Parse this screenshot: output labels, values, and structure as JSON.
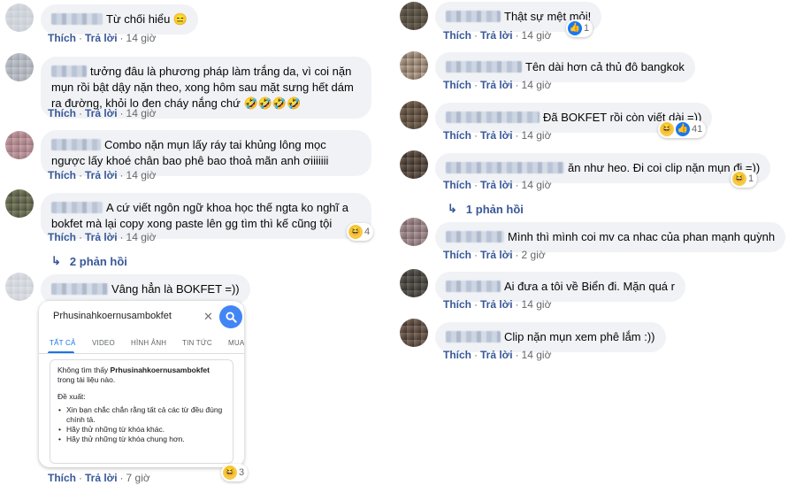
{
  "action_labels": {
    "like": "Thích",
    "reply": "Trả lời",
    "dot": "·"
  },
  "left_comments": [
    {
      "text": "Từ chối hiểu 😑",
      "time": "14 giờ"
    },
    {
      "text": "tưởng đâu là phương pháp làm trắng da, vì coi nặn mụn rồi bật dậy nặn theo, xong hôm sau mặt sưng hết dám ra đường, khỏi lo đen cháy nắng chứ 🤣🤣🤣🤣",
      "time": "14 giờ"
    },
    {
      "text": "Combo nặn mụn lấy ráy tai khủng lông mọc ngược lấy khoé chân bao phê bao thoả mãn anh ơiiiiiii",
      "time": "14 giờ"
    },
    {
      "text": "A cứ viết ngôn ngữ khoa học thế ngta ko nghĩ a bokfet mà lại copy xong paste lên gg tìm thì kế cũng tội",
      "time": "14 giờ",
      "reaction_count": "4",
      "replies": "2 phản hồi"
    },
    {
      "text": "Vâng hẳn là BOKFET =))",
      "time": "7 giờ",
      "reaction_count": "3"
    }
  ],
  "right_comments": [
    {
      "text": "Thật sự mệt mỏi!",
      "time": "14 giờ",
      "reaction_count": "1"
    },
    {
      "text": "Tên dài hơn cả thủ đô bangkok",
      "time": "14 giờ"
    },
    {
      "text": "Đã BOKFET rồi còn viết dài =))",
      "time": "14 giờ",
      "reaction_count": "41"
    },
    {
      "text": "ăn như heo. Đi coi clip nặn mụn đi =))",
      "time": "14 giờ",
      "reaction_count": "1",
      "replies": "1 phản hồi"
    },
    {
      "text": "Mình thì mình coi mv ca nhac của phan mạnh quỳnh",
      "time": "2 giờ"
    },
    {
      "text": "Ai đưa a tôi về Biển đi. Mặn quá r",
      "time": "14 giờ"
    },
    {
      "text": "Clip nặn mụn xem phê lắm :))",
      "time": "14 giờ"
    }
  ],
  "search": {
    "query": "Prhusinahkoernusambokfet",
    "tabs": [
      "TẤT CẢ",
      "VIDEO",
      "HÌNH ẢNH",
      "TIN TỨC",
      "MUA"
    ],
    "no_result_prefix": "Không tìm thấy",
    "no_result_term": "Prhusinahkoernusambokfet",
    "no_result_suffix": "trong tài liệu nào.",
    "suggest_title": "Đề xuất:",
    "suggestions": [
      "Xin bạn chắc chắn rằng tất cả các từ đều đúng chính tả.",
      "Hãy thử những từ khóa khác.",
      "Hãy thử những từ khóa chung hơn."
    ]
  },
  "colors": {
    "link": "#385898",
    "bubble": "#f0f2f5",
    "meta": "#65676b",
    "google_blue": "#4285f4"
  }
}
